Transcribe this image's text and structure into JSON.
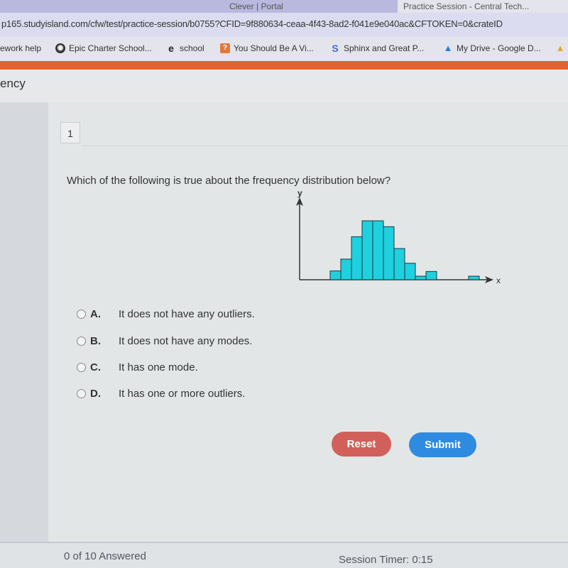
{
  "browser": {
    "tabs": [
      "",
      "Clever | Portal",
      "Practice Session - Central Tech..."
    ],
    "url": "p165.studyisland.com/cfw/test/practice-session/b0755?CFID=9f880634-ceaa-4f43-8ad2-f041e9e040ac&CFTOKEN=0&crateID",
    "bookmarks": [
      {
        "label": "ework help",
        "icon": ""
      },
      {
        "label": "Epic Charter School...",
        "icon": "globe-icon"
      },
      {
        "label": "school",
        "icon": "e-icon"
      },
      {
        "label": "You Should Be A Vi...",
        "icon": "question-icon"
      },
      {
        "label": "Sphinx and Great P...",
        "icon": "dollar-s-icon"
      },
      {
        "label": "My Drive - Google D...",
        "icon": "google-drive-icon"
      }
    ]
  },
  "page": {
    "subtitle": "ency",
    "question_number": "1",
    "question": "Which of the following is true about the frequency distribution below?",
    "options": [
      {
        "letter": "A.",
        "text": "It does not have any outliers."
      },
      {
        "letter": "B.",
        "text": "It does not have any modes."
      },
      {
        "letter": "C.",
        "text": "It has one mode."
      },
      {
        "letter": "D.",
        "text": "It has one or more outliers."
      }
    ],
    "reset_label": "Reset",
    "submit_label": "Submit",
    "answered": "0 of 10 Answered",
    "timer": "Session Timer: 0:15"
  },
  "colors": {
    "orange_bar": "#e0622f",
    "bar_fill": "#1fd0de",
    "reset": "#d2605a",
    "submit": "#2f8be0"
  },
  "chart_data": {
    "type": "bar",
    "xlabel": "x",
    "ylabel": "y",
    "bin_positions": [
      1,
      2,
      3,
      4,
      5,
      6,
      7,
      8,
      9,
      10,
      14
    ],
    "values": [
      1.5,
      3.5,
      7.3,
      10,
      10,
      9,
      5.3,
      2.8,
      0.6,
      1.4,
      0.6
    ],
    "grid": false
  }
}
